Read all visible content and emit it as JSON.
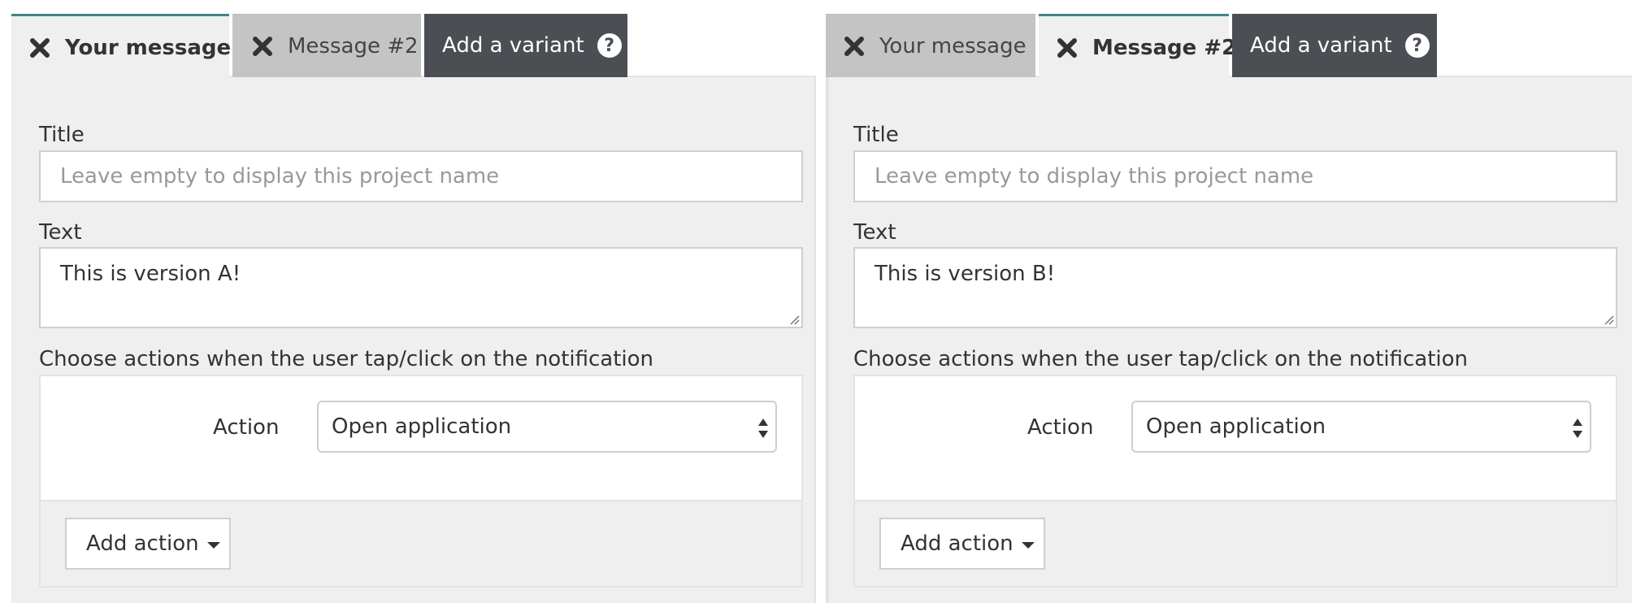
{
  "panels": [
    {
      "tabs": {
        "your_message": "Your message",
        "message2": "Message #2",
        "add_variant": "Add a variant",
        "help": "?"
      },
      "form": {
        "title_label": "Title",
        "title_placeholder": "Leave empty to display this project name",
        "text_label": "Text",
        "text_value": "This is version A!",
        "actions_label": "Choose actions when the user tap/click on the notification",
        "action_label": "Action",
        "action_value": "Open application",
        "add_action_label": "Add action"
      },
      "active_tab": "your_message"
    },
    {
      "tabs": {
        "your_message": "Your message",
        "message2": "Message #2",
        "add_variant": "Add a variant",
        "help": "?"
      },
      "form": {
        "title_label": "Title",
        "title_placeholder": "Leave empty to display this project name",
        "text_label": "Text",
        "text_value": "This is version B!",
        "actions_label": "Choose actions when the user tap/click on the notification",
        "action_label": "Action",
        "action_value": "Open application",
        "add_action_label": "Add action"
      },
      "active_tab": "message2"
    }
  ],
  "colors": {
    "active_tab_accent": "#41848c",
    "add_variant_bg": "#4b4f54",
    "inactive_tab_bg": "#c4c4c4",
    "panel_bg": "#efefef"
  },
  "icons": {
    "close": "close-icon",
    "help": "help-icon",
    "select_arrows": "select-arrows-icon",
    "caret": "caret-down-icon",
    "resize": "resize-grip-icon"
  }
}
